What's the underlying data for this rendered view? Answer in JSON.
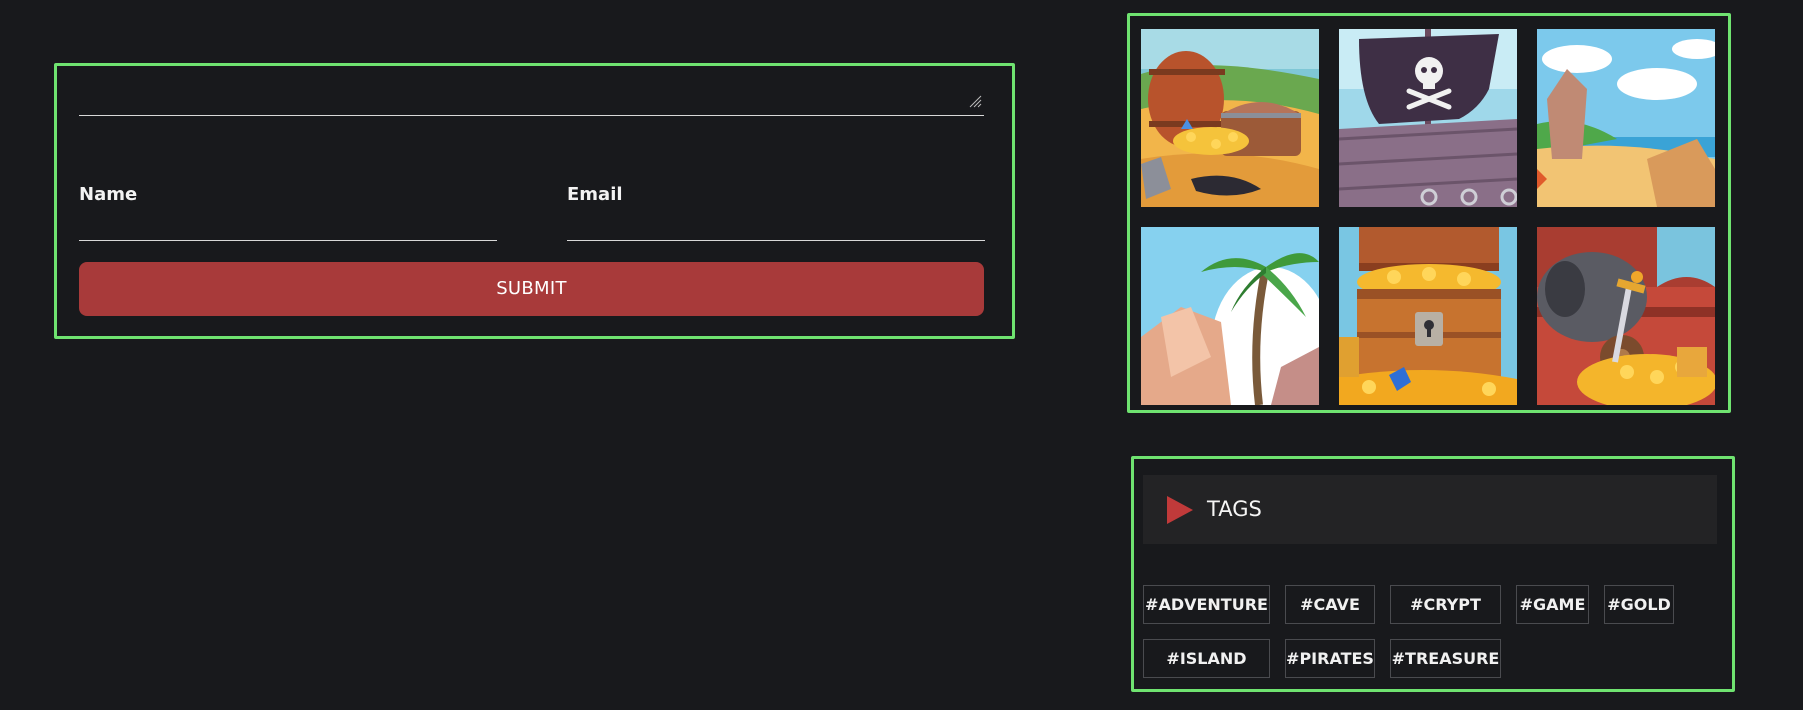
{
  "form": {
    "comment_value": "",
    "name_label": "Name",
    "name_value": "",
    "email_label": "Email",
    "email_value": "",
    "submit_label": "SUBMIT"
  },
  "gallery": {
    "images": [
      {
        "subject": "treasure-barrel-beach"
      },
      {
        "subject": "pirate-flag-ship"
      },
      {
        "subject": "island-shore"
      },
      {
        "subject": "palm-tree-island"
      },
      {
        "subject": "open-treasure-chest"
      },
      {
        "subject": "cannon-gold-sword"
      }
    ]
  },
  "tags": {
    "title": "TAGS",
    "items": [
      {
        "label": "#ADVENTURE"
      },
      {
        "label": "#CAVE"
      },
      {
        "label": "#CRYPT"
      },
      {
        "label": "#GAME"
      },
      {
        "label": "#GOLD"
      },
      {
        "label": "#ISLAND"
      },
      {
        "label": "#PIRATES"
      },
      {
        "label": "#TREASURE"
      }
    ]
  },
  "colors": {
    "background": "#18191c",
    "panel_outline": "#6fe370",
    "accent_red": "#a83a3a",
    "play_icon": "#c13a3a",
    "tags_header_bg": "#232325",
    "chip_border": "#4a4b4f"
  },
  "icons": {
    "tags_header": "play-triangle-icon",
    "textarea": "resize-grip-icon"
  }
}
